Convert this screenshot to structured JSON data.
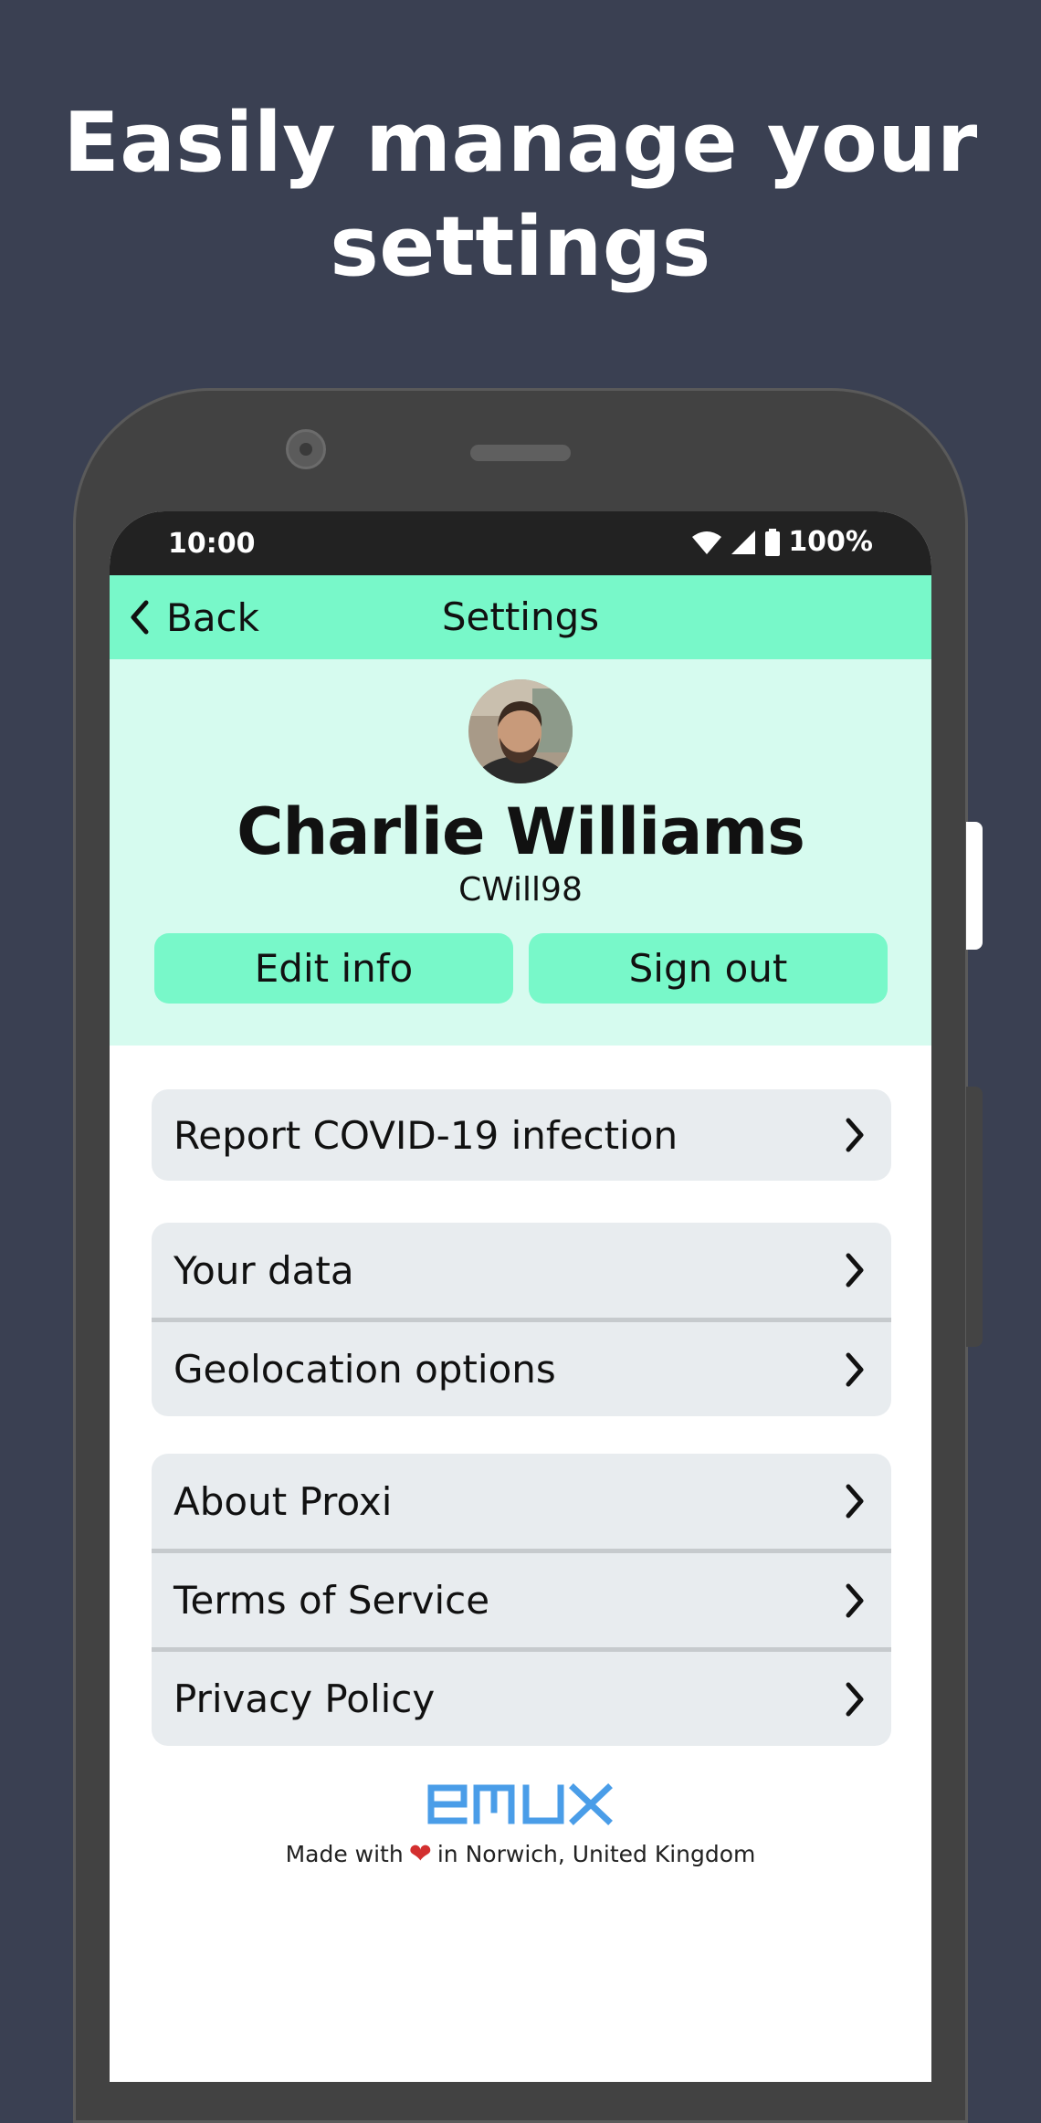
{
  "headline": {
    "line1": "Easily manage your",
    "line2": "settings"
  },
  "status_bar": {
    "time": "10:00",
    "battery": "100%",
    "icons": [
      "wifi-icon",
      "signal-icon",
      "battery-icon"
    ]
  },
  "appbar": {
    "back_label": "Back",
    "title": "Settings"
  },
  "profile": {
    "name": "Charlie Williams",
    "username": "CWill98",
    "edit_label": "Edit info",
    "signout_label": "Sign out"
  },
  "menu": {
    "report": "Report COVID-19 infection",
    "your_data": "Your data",
    "geolocation": "Geolocation options",
    "about": "About Proxi",
    "terms": "Terms of Service",
    "privacy": "Privacy Policy"
  },
  "footer": {
    "logo_text": "emux",
    "made_with": "Made with",
    "location": "in Norwich, United Kingdom"
  },
  "colors": {
    "background": "#3a4052",
    "accent": "#78f8c9",
    "profile_bg": "#d6fbef",
    "row_bg": "#e8ecef",
    "logo": "#4a9de8"
  }
}
